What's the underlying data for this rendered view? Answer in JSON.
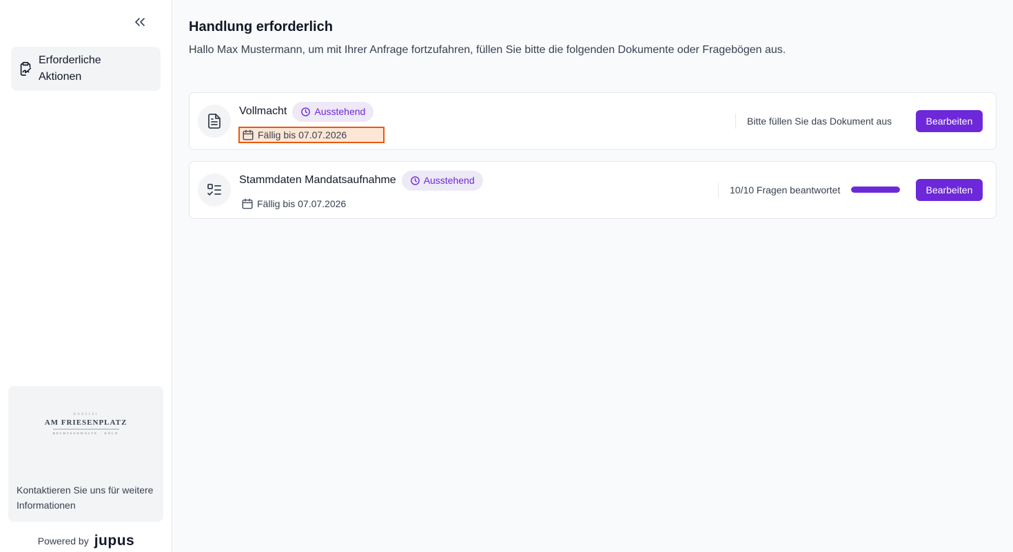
{
  "sidebar": {
    "nav_items": [
      {
        "label": "Erforderliche Aktionen",
        "icon": "clipboard-signature-icon"
      }
    ],
    "firm": {
      "logo_top": "KANZLEI",
      "logo_name": "AM FRIESENPLATZ",
      "logo_sub": "RECHTSANWÄLTE · KÖLN",
      "contact_text": "Kontaktieren Sie uns für weitere Informationen"
    },
    "powered_by": {
      "label": "Powered by",
      "brand": "jupus"
    }
  },
  "main": {
    "title": "Handlung erforderlich",
    "subtitle": "Hallo Max Mustermann, um mit Ihrer Anfrage fortzufahren, füllen Sie bitte die folgenden Dokumente oder Fragebögen aus.",
    "tasks": [
      {
        "title": "Vollmacht",
        "icon": "document-icon",
        "status": "Ausstehend",
        "due": "Fällig bis 07.07.2026",
        "info": "Bitte füllen Sie das Dokument aus",
        "button": "Bearbeiten"
      },
      {
        "title": "Stammdaten Mandatsaufnahme",
        "icon": "checklist-icon",
        "status": "Ausstehend",
        "due": "Fällig bis 07.07.2026",
        "info": "10/10 Fragen beantwortet",
        "progress": 1.0,
        "button": "Bearbeiten"
      }
    ]
  },
  "colors": {
    "accent": "#6d28d9",
    "badge_bg": "#ede9f6",
    "highlight_border": "#ea580c"
  }
}
